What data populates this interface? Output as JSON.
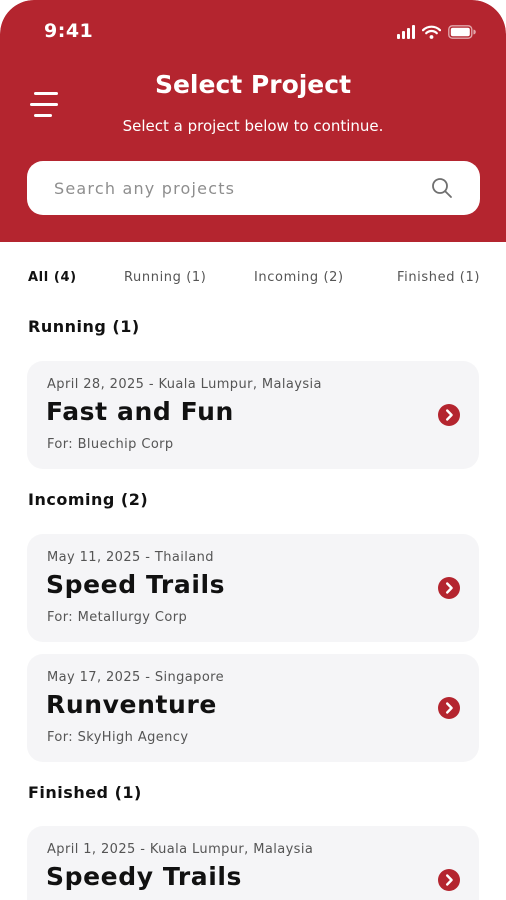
{
  "status_bar": {
    "time": "9:41"
  },
  "header": {
    "title": "Select Project",
    "subtitle": "Select a project below to continue."
  },
  "search": {
    "placeholder": "Search any projects",
    "value": ""
  },
  "tabs": [
    {
      "label": "All (4)",
      "active": true
    },
    {
      "label": "Running (1)",
      "active": false
    },
    {
      "label": "Incoming (2)",
      "active": false
    },
    {
      "label": "Finished (1)",
      "active": false
    }
  ],
  "sections": [
    {
      "title": "Running (1)",
      "projects": [
        {
          "meta": "April 28, 2025 - Kuala Lumpur, Malaysia",
          "name": "Fast and Fun",
          "client": "For: Bluechip Corp"
        }
      ]
    },
    {
      "title": "Incoming (2)",
      "projects": [
        {
          "meta": "May 11, 2025 - Thailand",
          "name": "Speed Trails",
          "client": "For: Metallurgy Corp"
        },
        {
          "meta": "May 17, 2025 - Singapore",
          "name": "Runventure",
          "client": "For: SkyHigh Agency"
        }
      ]
    },
    {
      "title": "Finished (1)",
      "projects": [
        {
          "meta": "April 1, 2025 - Kuala Lumpur, Malaysia",
          "name": "Speedy Trails",
          "client": ""
        }
      ]
    }
  ],
  "icons": {
    "menu": "menu-icon",
    "search": "search-icon",
    "card_arrow": "chevron-right-circle-icon",
    "signal": "signal-icon",
    "wifi": "wifi-icon",
    "battery": "battery-icon"
  },
  "colors": {
    "brand": "#b4252f",
    "card_background": "#f5f5f7",
    "text_primary": "#111111",
    "text_secondary": "#555555"
  }
}
